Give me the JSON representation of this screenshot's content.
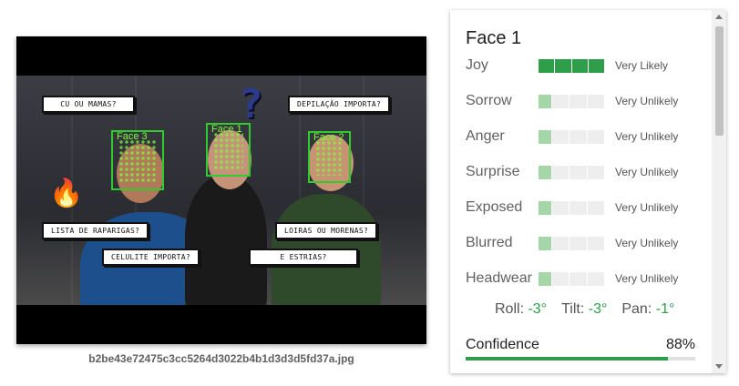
{
  "image": {
    "filename": "b2be43e72475c3cc5264d3022b4b1d3d3d5fd37a.jpg",
    "captions": {
      "cu_ou_mamas": "CU OU MAMAS?",
      "depilacao": "DEPILAÇÃO IMPORTA?",
      "lista": "LISTA DE RAPARIGAS?",
      "loiras": "LOIRAS OU MORENAS?",
      "celulite": "CELULITE IMPORTA?",
      "estrias": "E ESTRIAS?"
    },
    "faces": [
      {
        "label": "Face 3"
      },
      {
        "label": "Face 1"
      },
      {
        "label": "Face 2"
      }
    ]
  },
  "panel": {
    "title": "Face 1",
    "attributes": [
      {
        "name": "Joy",
        "likelihood": "Very Likely",
        "level": 4,
        "levels": 4
      },
      {
        "name": "Sorrow",
        "likelihood": "Very Unlikely",
        "level": 1,
        "levels": 4
      },
      {
        "name": "Anger",
        "likelihood": "Very Unlikely",
        "level": 1,
        "levels": 4
      },
      {
        "name": "Surprise",
        "likelihood": "Very Unlikely",
        "level": 1,
        "levels": 4
      },
      {
        "name": "Exposed",
        "likelihood": "Very Unlikely",
        "level": 1,
        "levels": 4
      },
      {
        "name": "Blurred",
        "likelihood": "Very Unlikely",
        "level": 1,
        "levels": 4
      },
      {
        "name": "Headwear",
        "likelihood": "Very Unlikely",
        "level": 1,
        "levels": 4
      }
    ],
    "angles": {
      "roll_label": "Roll:",
      "roll": "-3°",
      "tilt_label": "Tilt:",
      "tilt": "-3°",
      "pan_label": "Pan:",
      "pan": "-1°"
    },
    "confidence": {
      "label": "Confidence",
      "value": "88%",
      "fraction": 0.88
    }
  },
  "colors": {
    "accent": "#2e9e4a",
    "accent_light": "#a5d6a7",
    "face_box": "#2ecc2e"
  },
  "icons": [
    "question-mark-sticker-icon",
    "flame-sticker-icon",
    "scroll-up-icon",
    "scroll-down-icon"
  ]
}
